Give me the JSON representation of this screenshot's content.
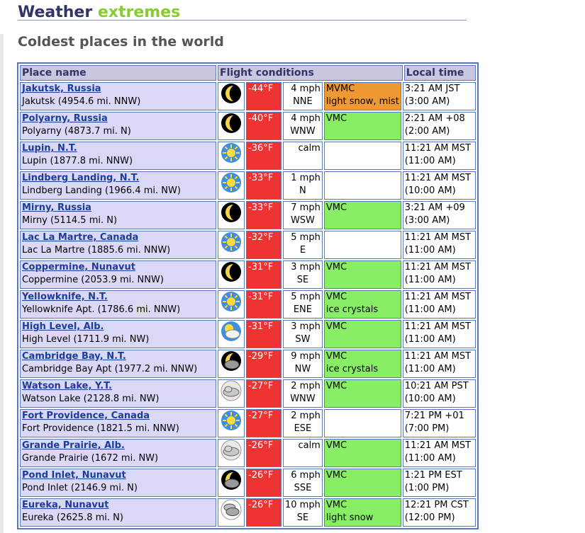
{
  "header": {
    "title_part1": "Weather",
    "title_part2": "extremes",
    "subtitle": "Coldest places in the world"
  },
  "table": {
    "columns": [
      "Place name",
      "Flight conditions",
      "Local time"
    ],
    "rows": [
      {
        "place": "Jakutsk, Russia",
        "station": "Jakutsk (4954.6 mi. NNW)",
        "icon": "moon-icon",
        "temp": "-44°F",
        "wind_speed": "4 mph",
        "wind_dir": "NNE",
        "condition": "MVMC",
        "weather": "light snow, mist",
        "time": "3:21 AM JST",
        "time_alt": "(3:00 AM)",
        "cond_class": "mvmc"
      },
      {
        "place": "Polyarny, Russia",
        "station": "Polyarny (4873.7 mi. N)",
        "icon": "moon-icon",
        "temp": "-40°F",
        "wind_speed": "4 mph",
        "wind_dir": "WNW",
        "condition": "VMC",
        "weather": "",
        "time": "2:21 AM +08",
        "time_alt": "(2:00 AM)",
        "cond_class": "vmc"
      },
      {
        "place": "Lupin, N.T.",
        "station": "Lupin (1877.8 mi. NNW)",
        "icon": "sun-icon",
        "temp": "-36°F",
        "wind_speed": "calm",
        "wind_dir": "",
        "condition": "",
        "weather": "",
        "time": "11:21 AM MST",
        "time_alt": "(11:00 AM)",
        "cond_class": "none"
      },
      {
        "place": "Lindberg Landing, N.T.",
        "station": "Lindberg Landing (1966.4 mi. NW)",
        "icon": "sun-icon",
        "temp": "-33°F",
        "wind_speed": "1 mph",
        "wind_dir": "N",
        "condition": "",
        "weather": "",
        "time": "11:21 AM MST",
        "time_alt": "(10:00 AM)",
        "cond_class": "none"
      },
      {
        "place": "Mirny, Russia",
        "station": "Mirny (5114.5 mi. N)",
        "icon": "moon-icon",
        "temp": "-33°F",
        "wind_speed": "7 mph",
        "wind_dir": "WSW",
        "condition": "VMC",
        "weather": "",
        "time": "3:21 AM +09",
        "time_alt": "(3:00 AM)",
        "cond_class": "vmc"
      },
      {
        "place": "Lac La Martre, Canada",
        "station": "Lac La Martre (1885.6 mi. NNW)",
        "icon": "sun-icon",
        "temp": "-32°F",
        "wind_speed": "5 mph",
        "wind_dir": "E",
        "condition": "",
        "weather": "",
        "time": "11:21 AM MST",
        "time_alt": "(11:00 AM)",
        "cond_class": "none"
      },
      {
        "place": "Coppermine, Nunavut",
        "station": "Coppermine (2053.9 mi. NNW)",
        "icon": "moon-icon",
        "temp": "-31°F",
        "wind_speed": "3 mph",
        "wind_dir": "SE",
        "condition": "VMC",
        "weather": "",
        "time": "11:21 AM MST",
        "time_alt": "(11:00 AM)",
        "cond_class": "vmc"
      },
      {
        "place": "Yellowknife, N.T.",
        "station_pre": "Yellowknife Apt. (1786.6 ",
        "station_hl": "mi",
        "station_post": ". NNW)",
        "icon": "sun-icon",
        "temp": "-31°F",
        "wind_speed": "5 mph",
        "wind_dir": "ENE",
        "condition": "VMC",
        "weather": "ice crystals",
        "time": "11:21 AM MST",
        "time_alt": "(11:00 AM)",
        "cond_class": "vmc"
      },
      {
        "place": "High Level, Alb.",
        "station": "High Level (1711.9 mi. NW)",
        "icon": "sun-cloud-icon",
        "temp": "-31°F",
        "wind_speed": "3 mph",
        "wind_dir": "SW",
        "condition": "VMC",
        "weather": "",
        "time": "11:21 AM MST",
        "time_alt": "(11:00 AM)",
        "cond_class": "vmc"
      },
      {
        "place": "Cambridge Bay, N.T.",
        "station": "Cambridge Bay Apt (1977.2 mi. NNW)",
        "icon": "moon-cloud-icon",
        "temp": "-29°F",
        "wind_speed": "9 mph",
        "wind_dir": "NW",
        "condition": "VMC",
        "weather": "ice crystals",
        "time": "11:21 AM MST",
        "time_alt": "(11:00 AM)",
        "cond_class": "vmc"
      },
      {
        "place": "Watson Lake, Y.T.",
        "station": "Watson Lake (2128.8 mi. NW)",
        "icon": "cloud-icon",
        "temp": "-27°F",
        "wind_speed": "2 mph",
        "wind_dir": "WNW",
        "condition": "VMC",
        "weather": "",
        "time": "10:21 AM PST",
        "time_alt": "(10:00 AM)",
        "cond_class": "vmc"
      },
      {
        "place": "Fort Providence, Canada",
        "station": "Fort Providence (1821.5 mi. NNW)",
        "icon": "sun-icon",
        "temp": "-27°F",
        "wind_speed": "2 mph",
        "wind_dir": "ESE",
        "condition": "",
        "weather": "",
        "time": "7:21 PM +01",
        "time_alt": "(7:00 PM)",
        "cond_class": "none"
      },
      {
        "place": "Grande Prairie, Alb.",
        "station": "Grande Prairie (1672 mi. NW)",
        "icon": "cloud-icon",
        "temp": "-26°F",
        "wind_speed": "calm",
        "wind_dir": "",
        "condition": "VMC",
        "weather": "",
        "time": "11:21 AM MST",
        "time_alt": "(11:00 AM)",
        "cond_class": "vmc"
      },
      {
        "place": "Pond Inlet, Nunavut",
        "station": "Pond Inlet (2146.9 mi. N)",
        "icon": "moon-cloud-icon",
        "temp": "-26°F",
        "wind_speed": "6 mph",
        "wind_dir": "SSE",
        "condition": "VMC",
        "weather": "",
        "time": "1:21 PM EST",
        "time_alt": "(1:00 PM)",
        "cond_class": "vmc"
      },
      {
        "place": "Eureka, Nunavut",
        "station": "Eureka (2625.8 mi. N)",
        "icon": "overcast-icon",
        "temp": "-26°F",
        "wind_speed": "10 mph",
        "wind_dir": "SE",
        "condition": "VMC",
        "weather": "light snow",
        "time": "12:21 PM CST",
        "time_alt": "(12:00 PM)",
        "cond_class": "vmc"
      }
    ]
  }
}
